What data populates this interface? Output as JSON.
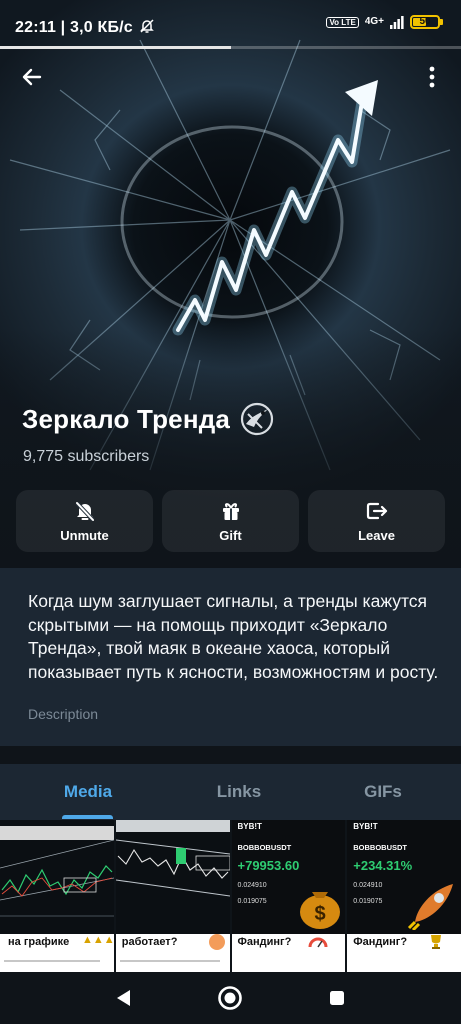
{
  "status_bar": {
    "time_speed": "22:11 | 3,0 КБ/с",
    "volte": "Vo LTE",
    "network": "4G+",
    "battery": "50",
    "battery_fraction": 0.5,
    "page_load_fraction": 0.5
  },
  "channel": {
    "title": "Зеркало Тренда",
    "subscribers": "9,775 subscribers"
  },
  "actions": [
    {
      "label": "Unmute",
      "icon": "bell-off-icon"
    },
    {
      "label": "Gift",
      "icon": "gift-icon"
    },
    {
      "label": "Leave",
      "icon": "leave-icon"
    }
  ],
  "description": {
    "text": "Когда шум заглушает сигналы, а тренды кажутся скрытыми — на помощь приходит «Зеркало Тренда», твой маяк в океане хаоса, который показывает путь к ясности, возможностям и росту.",
    "label": "Description"
  },
  "tabs": [
    {
      "label": "Media",
      "active": true
    },
    {
      "label": "Links",
      "active": false
    },
    {
      "label": "GIFs",
      "active": false
    }
  ],
  "media": [
    {
      "caption": "на графике"
    },
    {
      "caption": "работает?"
    },
    {
      "caption": "Фандинг?",
      "brand": "BYB!T",
      "pair": "BOBBOBUSDT",
      "price": "+79953.60",
      "v1": "0.024910",
      "v2": "0.019075"
    },
    {
      "caption": "Фандинг?",
      "brand": "BYB!T",
      "pair": "BOBBOBUSDT",
      "price": "+234.31%",
      "v1": "0.024910",
      "v2": "0.019075"
    }
  ],
  "colors": {
    "accent": "#4fa9e9",
    "card": "#1c2733",
    "background": "#0f1419",
    "battery": "#f2c200",
    "profit": "#2ecc71"
  }
}
